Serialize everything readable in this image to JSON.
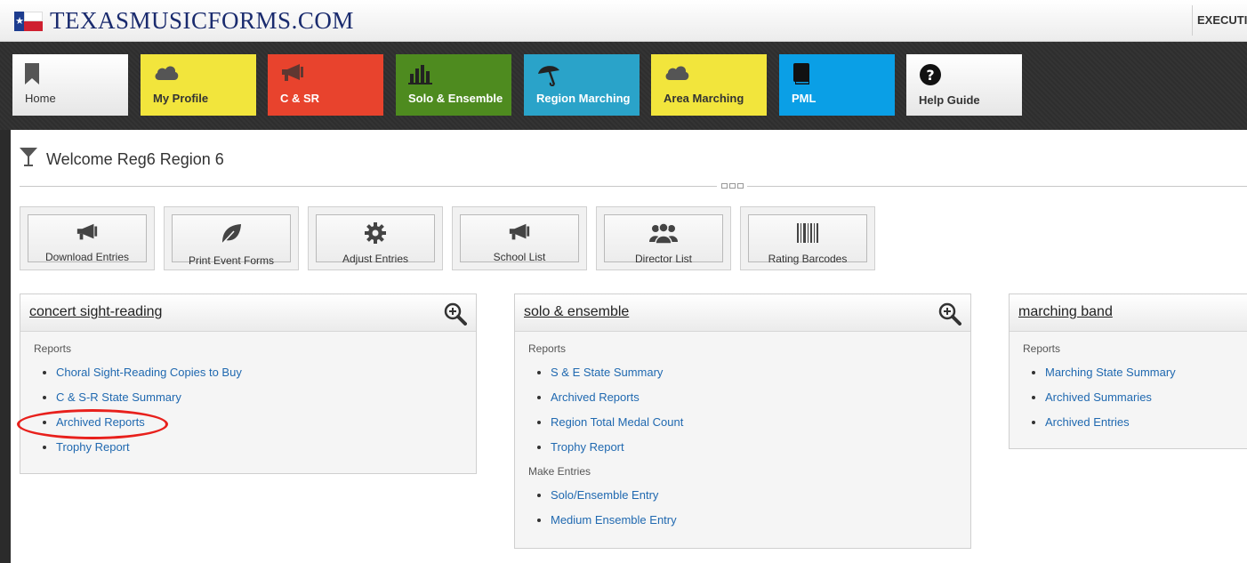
{
  "header": {
    "logo_text": "TEXASMUSICFORMS.COM",
    "exec_label": "EXECUTI"
  },
  "nav": {
    "tiles": [
      {
        "label": "Home",
        "icon": "bookmark-icon"
      },
      {
        "label": "My Profile",
        "icon": "cloud-icon"
      },
      {
        "label": "C & SR",
        "icon": "megaphone-icon"
      },
      {
        "label": "Solo & Ensemble",
        "icon": "bar-chart-icon"
      },
      {
        "label": "Region Marching",
        "icon": "umbrella-icon"
      },
      {
        "label": "Area Marching",
        "icon": "cloud-icon"
      },
      {
        "label": "PML",
        "icon": "book-icon"
      },
      {
        "label": "Help Guide",
        "icon": "question-icon"
      }
    ]
  },
  "welcome": {
    "text": "Welcome Reg6 Region 6"
  },
  "quick_buttons": [
    {
      "label": "Download Entries",
      "icon": "megaphone-icon"
    },
    {
      "label": "Print Event Forms",
      "icon": "leaf-icon"
    },
    {
      "label": "Adjust Entries",
      "icon": "gear-icon"
    },
    {
      "label": "School List",
      "icon": "megaphone-icon"
    },
    {
      "label": "Director List",
      "icon": "users-icon"
    },
    {
      "label": "Rating Barcodes",
      "icon": "barcode-icon"
    }
  ],
  "panels": {
    "csr": {
      "title": "concert sight-reading",
      "reports_label": "Reports",
      "links": [
        "Choral Sight-Reading Copies to Buy",
        "C & S-R State Summary",
        "Archived Reports",
        "Trophy Report"
      ]
    },
    "se": {
      "title": "solo & ensemble",
      "reports_label": "Reports",
      "links": [
        "S & E State Summary",
        "Archived Reports",
        "Region Total Medal Count",
        "Trophy Report"
      ],
      "entries_label": "Make Entries",
      "entry_links": [
        "Solo/Ensemble Entry",
        "Medium Ensemble Entry"
      ]
    },
    "mb": {
      "title": "marching band",
      "reports_label": "Reports",
      "links": [
        "Marching State Summary",
        "Archived Summaries",
        "Archived Entries"
      ]
    }
  },
  "colors": {
    "link": "#2069b0",
    "annotation": "#e8201c"
  }
}
